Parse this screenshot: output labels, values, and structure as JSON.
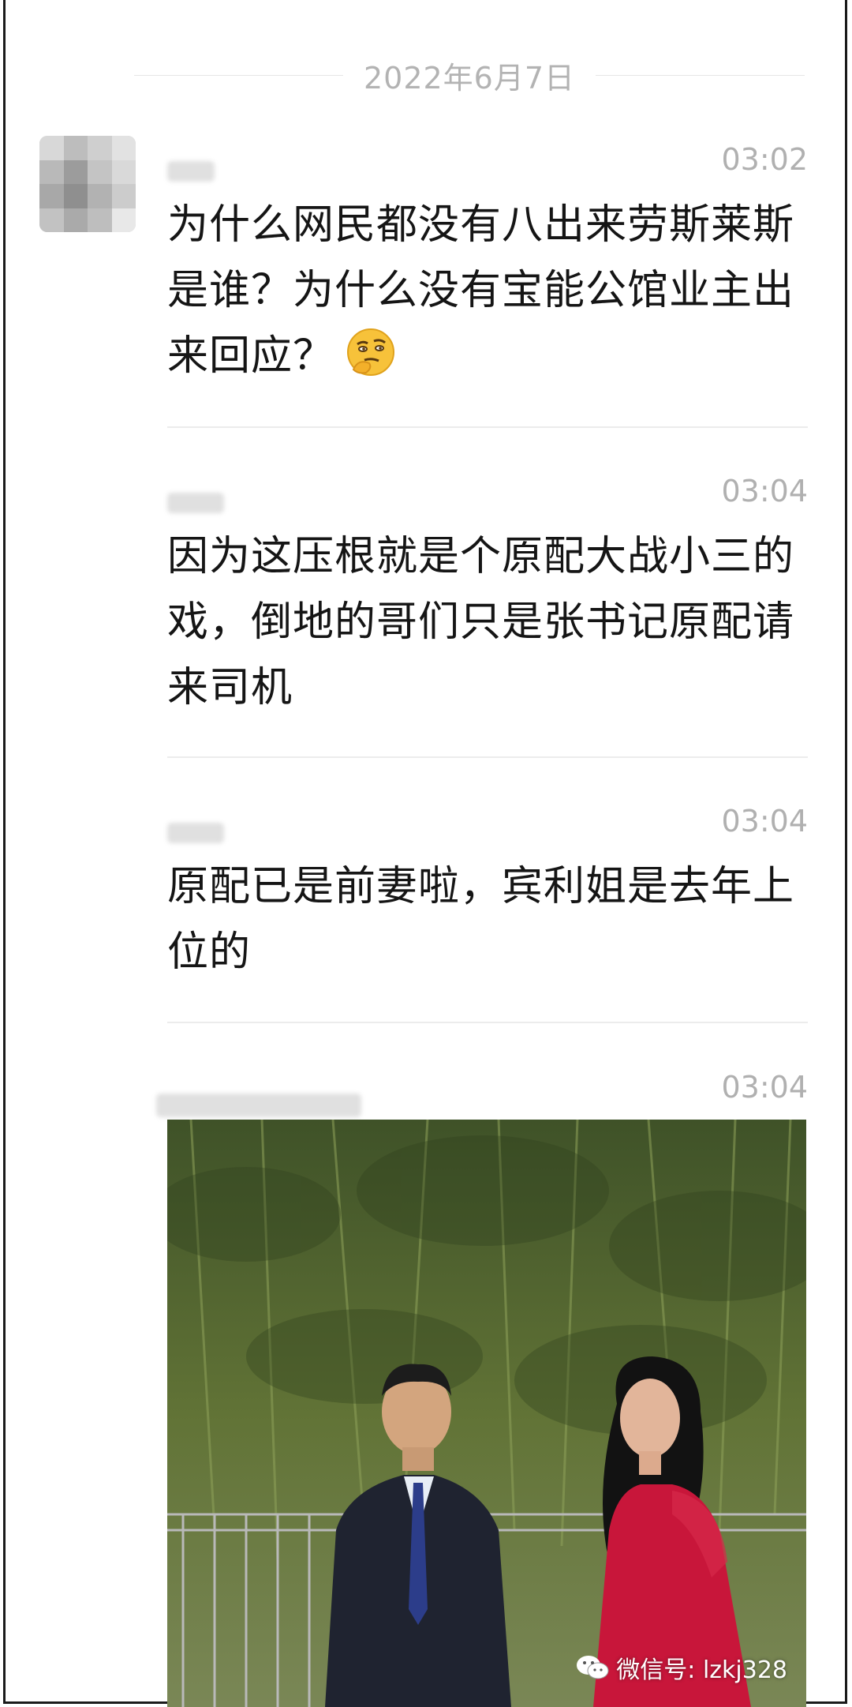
{
  "chat": {
    "date_label": "2022年6月7日",
    "messages": [
      {
        "time": "03:02",
        "text": "为什么网民都没有八出来劳斯莱斯是谁？为什么没有宝能公馆业主出来回应？",
        "emoji": "thinking-emoji"
      },
      {
        "time": "03:04",
        "text": "因为这压根就是个原配大战小三的戏，倒地的哥们只是张书记原配请来司机"
      },
      {
        "time": "03:04",
        "text": "原配已是前妻啦，宾利姐是去年上位的"
      },
      {
        "time": "03:04",
        "image": "photo-couple-in-front-of-bamboo"
      }
    ]
  },
  "watermark": {
    "text": "微信号: lzkj328",
    "icon": "wechat-icon"
  },
  "colors": {
    "time_text": "#b0b0b0",
    "message_text": "#151515",
    "divider": "#ececec",
    "dress": "#c8163a"
  }
}
